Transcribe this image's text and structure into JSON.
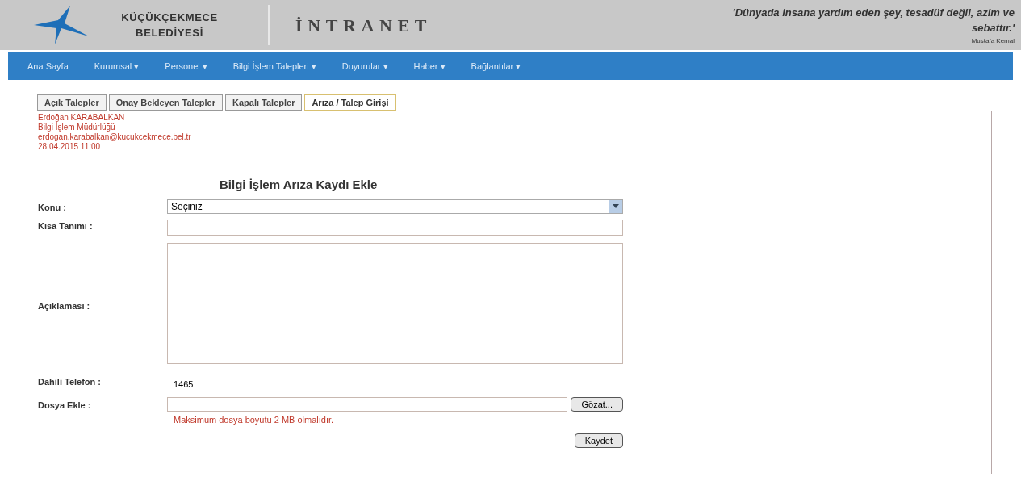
{
  "header": {
    "logo_line_1": "KÜÇÜKÇEKMECE",
    "logo_line_2": "BELEDİYESİ",
    "site_title": "İNTRANET",
    "quote": "'Dünyada insana yardım eden şey, tesadüf değil, azim ve",
    "quote_end": "sebattır.'",
    "quote_author": "Mustafa Kemal"
  },
  "nav": [
    {
      "label": "Ana Sayfa"
    },
    {
      "label": "Kurumsal ▾"
    },
    {
      "label": "Personel ▾"
    },
    {
      "label": "Bilgi İşlem Talepleri ▾"
    },
    {
      "label": "Duyurular ▾"
    },
    {
      "label": "Haber ▾"
    },
    {
      "label": "Bağlantılar ▾"
    }
  ],
  "tabs": [
    {
      "label": "Açık Talepler",
      "selected": false
    },
    {
      "label": "Onay Bekleyen Talepler",
      "selected": false
    },
    {
      "label": "Kapalı Talepler",
      "selected": false
    },
    {
      "label": "Arıza / Talep Girişi",
      "selected": true
    }
  ],
  "user_info": [
    "Erdoğan KARABALKAN",
    "Bilgi İşlem Müdürlüğü",
    "erdogan.karabalkan@kucukcekmece.bel.tr",
    "28.04.2015 11:00"
  ],
  "form": {
    "title": "Bilgi İşlem Arıza Kaydı Ekle",
    "fields": [
      {
        "kind": "select",
        "label": "Konu :",
        "value": "Seçiniz"
      },
      {
        "kind": "text",
        "label": "Kısa Tanımı :"
      },
      {
        "kind": "textarea",
        "label": "Açıklaması :"
      },
      {
        "kind": "static",
        "label": "Dahili Telefon :",
        "value": "1465"
      },
      {
        "kind": "file",
        "label": "Dosya Ekle :",
        "button": "Gözat...",
        "note": "Maksimum dosya boyutu 2 MB olmalıdır."
      }
    ],
    "submit": "Kaydet"
  }
}
